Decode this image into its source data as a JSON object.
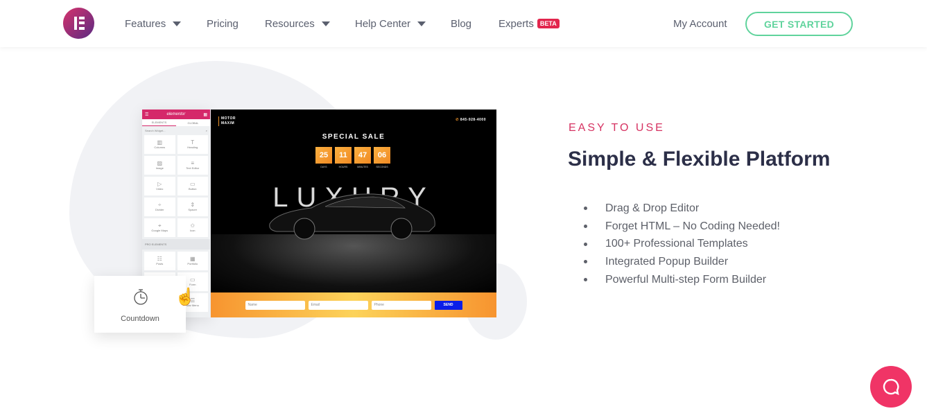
{
  "nav": {
    "items": [
      {
        "label": "Features",
        "dropdown": true
      },
      {
        "label": "Pricing"
      },
      {
        "label": "Resources",
        "dropdown": true
      },
      {
        "label": "Help Center",
        "dropdown": true
      },
      {
        "label": "Blog"
      },
      {
        "label": "Experts",
        "badge": "BETA"
      }
    ],
    "account": "My Account",
    "cta": "GET STARTED"
  },
  "editor": {
    "logo": "elementor",
    "tabs": [
      "ELEMENTS",
      "GLOBAL"
    ],
    "search_placeholder": "Search Widget...",
    "widgets": [
      "Columns",
      "Heading",
      "Image",
      "Text Editor",
      "Video",
      "Button",
      "Divider",
      "Spacer",
      "Google Maps",
      "Icon"
    ],
    "pro_label": "PRO ELEMENTS",
    "pro_widgets": [
      "Posts",
      "Portfolio",
      "",
      "Form",
      "",
      "Nav Menu"
    ]
  },
  "preview": {
    "brand_line1": "MOTOR",
    "brand_line2": "MAXIM",
    "phone": "845-928-4000",
    "sale": "SPECIAL SALE",
    "countdown": [
      {
        "n": "25",
        "l": "DAYS"
      },
      {
        "n": "11",
        "l": "HOURS"
      },
      {
        "n": "47",
        "l": "MINUTES"
      },
      {
        "n": "06",
        "l": "SECONDS"
      }
    ],
    "headline": "LUXURY",
    "form": {
      "name": "Name",
      "email": "Email",
      "phone": "Phone",
      "send": "SEND"
    }
  },
  "card": {
    "label": "Countdown"
  },
  "feature": {
    "eyebrow": "EASY TO USE",
    "title": "Simple & Flexible Platform",
    "bullets": [
      "Drag & Drop Editor",
      "Forget HTML – No Coding Needed!",
      "100+ Professional Templates",
      "Integrated Popup Builder",
      "Powerful Multi-step Form Builder"
    ]
  },
  "colors": {
    "accent": "#d63362",
    "cta": "#5fd39c",
    "chat": "#f03466",
    "title": "#2c2f48"
  }
}
